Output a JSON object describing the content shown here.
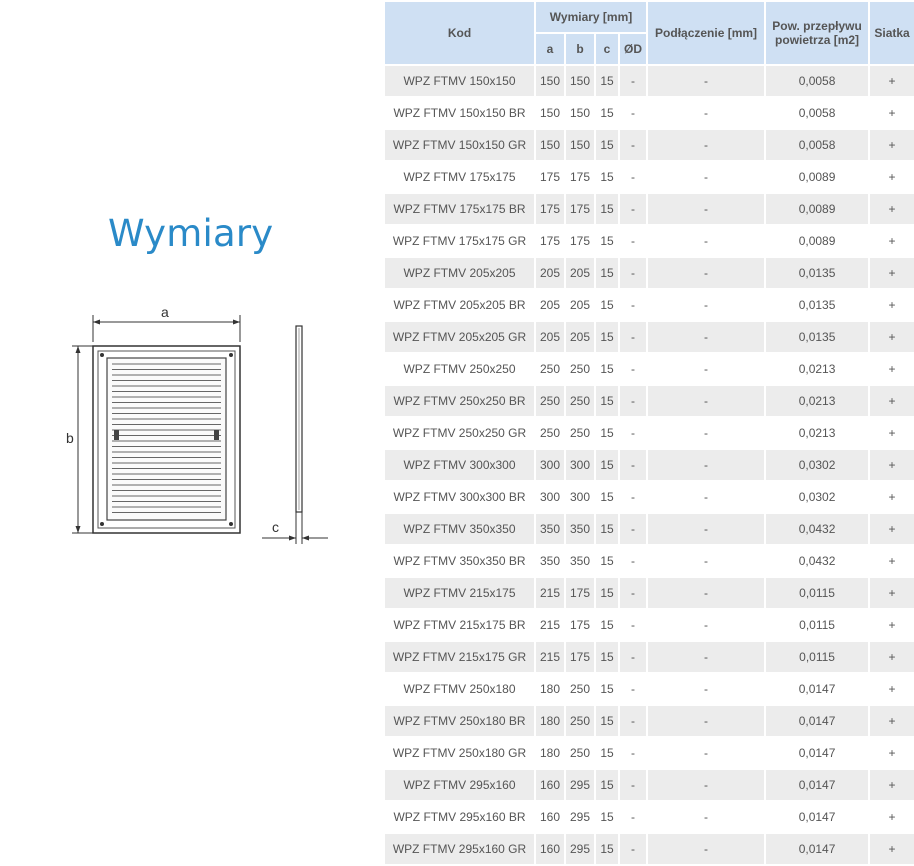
{
  "left": {
    "heading": "Wymiary",
    "diagram": {
      "label_a": "a",
      "label_b": "b",
      "label_c": "c"
    }
  },
  "table": {
    "headers": {
      "kod": "Kod",
      "wymiary": "Wymiary [mm]",
      "a": "a",
      "b": "b",
      "c": "c",
      "d": "ØD",
      "podlaczenie": "Podłączenie [mm]",
      "pow_line1": "Pow. przepływu",
      "pow_line2": "powietrza [m2]",
      "siatka": "Siatka"
    },
    "rows": [
      {
        "kod": "WPZ FTMV 150x150",
        "a": "150",
        "b": "150",
        "c": "15",
        "d": "-",
        "pod": "-",
        "pow": "0,0058",
        "siatka": "+"
      },
      {
        "kod": "WPZ FTMV 150x150 BR",
        "a": "150",
        "b": "150",
        "c": "15",
        "d": "-",
        "pod": "-",
        "pow": "0,0058",
        "siatka": "+"
      },
      {
        "kod": "WPZ FTMV 150x150 GR",
        "a": "150",
        "b": "150",
        "c": "15",
        "d": "-",
        "pod": "-",
        "pow": "0,0058",
        "siatka": "+"
      },
      {
        "kod": "WPZ FTMV 175x175",
        "a": "175",
        "b": "175",
        "c": "15",
        "d": "-",
        "pod": "-",
        "pow": "0,0089",
        "siatka": "+"
      },
      {
        "kod": "WPZ FTMV 175x175 BR",
        "a": "175",
        "b": "175",
        "c": "15",
        "d": "-",
        "pod": "-",
        "pow": "0,0089",
        "siatka": "+"
      },
      {
        "kod": "WPZ FTMV 175x175 GR",
        "a": "175",
        "b": "175",
        "c": "15",
        "d": "-",
        "pod": "-",
        "pow": "0,0089",
        "siatka": "+"
      },
      {
        "kod": "WPZ FTMV 205x205",
        "a": "205",
        "b": "205",
        "c": "15",
        "d": "-",
        "pod": "-",
        "pow": "0,0135",
        "siatka": "+"
      },
      {
        "kod": "WPZ FTMV 205x205 BR",
        "a": "205",
        "b": "205",
        "c": "15",
        "d": "-",
        "pod": "-",
        "pow": "0,0135",
        "siatka": "+"
      },
      {
        "kod": "WPZ FTMV 205x205 GR",
        "a": "205",
        "b": "205",
        "c": "15",
        "d": "-",
        "pod": "-",
        "pow": "0,0135",
        "siatka": "+"
      },
      {
        "kod": "WPZ FTMV 250x250",
        "a": "250",
        "b": "250",
        "c": "15",
        "d": "-",
        "pod": "-",
        "pow": "0,0213",
        "siatka": "+"
      },
      {
        "kod": "WPZ FTMV 250x250 BR",
        "a": "250",
        "b": "250",
        "c": "15",
        "d": "-",
        "pod": "-",
        "pow": "0,0213",
        "siatka": "+"
      },
      {
        "kod": "WPZ FTMV 250x250 GR",
        "a": "250",
        "b": "250",
        "c": "15",
        "d": "-",
        "pod": "-",
        "pow": "0,0213",
        "siatka": "+"
      },
      {
        "kod": "WPZ FTMV 300x300",
        "a": "300",
        "b": "300",
        "c": "15",
        "d": "-",
        "pod": "-",
        "pow": "0,0302",
        "siatka": "+"
      },
      {
        "kod": "WPZ FTMV 300x300 BR",
        "a": "300",
        "b": "300",
        "c": "15",
        "d": "-",
        "pod": "-",
        "pow": "0,0302",
        "siatka": "+"
      },
      {
        "kod": "WPZ FTMV 350x350",
        "a": "350",
        "b": "350",
        "c": "15",
        "d": "-",
        "pod": "-",
        "pow": "0,0432",
        "siatka": "+"
      },
      {
        "kod": "WPZ FTMV 350x350 BR",
        "a": "350",
        "b": "350",
        "c": "15",
        "d": "-",
        "pod": "-",
        "pow": "0,0432",
        "siatka": "+"
      },
      {
        "kod": "WPZ FTMV 215x175",
        "a": "215",
        "b": "175",
        "c": "15",
        "d": "-",
        "pod": "-",
        "pow": "0,0115",
        "siatka": "+"
      },
      {
        "kod": "WPZ FTMV 215x175 BR",
        "a": "215",
        "b": "175",
        "c": "15",
        "d": "-",
        "pod": "-",
        "pow": "0,0115",
        "siatka": "+"
      },
      {
        "kod": "WPZ FTMV 215x175 GR",
        "a": "215",
        "b": "175",
        "c": "15",
        "d": "-",
        "pod": "-",
        "pow": "0,0115",
        "siatka": "+"
      },
      {
        "kod": "WPZ FTMV 250x180",
        "a": "180",
        "b": "250",
        "c": "15",
        "d": "-",
        "pod": "-",
        "pow": "0,0147",
        "siatka": "+"
      },
      {
        "kod": "WPZ FTMV 250x180 BR",
        "a": "180",
        "b": "250",
        "c": "15",
        "d": "-",
        "pod": "-",
        "pow": "0,0147",
        "siatka": "+"
      },
      {
        "kod": "WPZ FTMV 250x180 GR",
        "a": "180",
        "b": "250",
        "c": "15",
        "d": "-",
        "pod": "-",
        "pow": "0,0147",
        "siatka": "+"
      },
      {
        "kod": "WPZ FTMV 295x160",
        "a": "160",
        "b": "295",
        "c": "15",
        "d": "-",
        "pod": "-",
        "pow": "0,0147",
        "siatka": "+"
      },
      {
        "kod": "WPZ FTMV 295x160 BR",
        "a": "160",
        "b": "295",
        "c": "15",
        "d": "-",
        "pod": "-",
        "pow": "0,0147",
        "siatka": "+"
      },
      {
        "kod": "WPZ FTMV 295x160 GR",
        "a": "160",
        "b": "295",
        "c": "15",
        "d": "-",
        "pod": "-",
        "pow": "0,0147",
        "siatka": "+"
      }
    ]
  },
  "colors": {
    "heading": "#2a8ac8",
    "header_bg": "#cfe0f3",
    "row_alt_bg": "#ececec",
    "text": "#555555"
  }
}
